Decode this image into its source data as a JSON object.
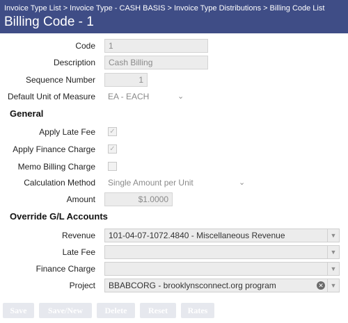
{
  "breadcrumb": {
    "items": [
      "Invoice Type List",
      "Invoice Type - CASH BASIS",
      "Invoice Type Distributions",
      "Billing Code List"
    ],
    "separator": ">"
  },
  "page_title": "Billing Code - 1",
  "fields": {
    "code": {
      "label": "Code",
      "value": "1"
    },
    "description": {
      "label": "Description",
      "value": "Cash Billing"
    },
    "sequence_number": {
      "label": "Sequence Number",
      "value": "1"
    },
    "default_uom": {
      "label": "Default Unit of Measure",
      "value": "EA - EACH"
    }
  },
  "general": {
    "heading": "General",
    "apply_late_fee": {
      "label": "Apply Late Fee",
      "checked": true
    },
    "apply_finance_charge": {
      "label": "Apply Finance Charge",
      "checked": true
    },
    "memo_billing_charge": {
      "label": "Memo Billing Charge",
      "checked": false
    },
    "calculation_method": {
      "label": "Calculation Method",
      "value": "Single Amount per Unit"
    },
    "amount": {
      "label": "Amount",
      "value": "$1.0000"
    }
  },
  "override": {
    "heading": "Override G/L Accounts",
    "revenue": {
      "label": "Revenue",
      "value": "101-04-07-1072.4840 - Miscellaneous Revenue"
    },
    "late_fee": {
      "label": "Late Fee",
      "value": ""
    },
    "finance_charge": {
      "label": "Finance Charge",
      "value": ""
    },
    "project": {
      "label": "Project",
      "value": "BBABCORG - brooklynsconnect.org program"
    }
  },
  "buttons": {
    "save": "Save",
    "save_new": "Save/New",
    "delete": "Delete",
    "reset": "Reset",
    "rates": "Rates"
  },
  "icons": {
    "check": "check-icon",
    "dropdown": "chevron-down-icon",
    "clear": "clear-icon"
  },
  "colors": {
    "header_bg": "#3f4d86",
    "button_disabled_bg": "#e6e8ee"
  }
}
